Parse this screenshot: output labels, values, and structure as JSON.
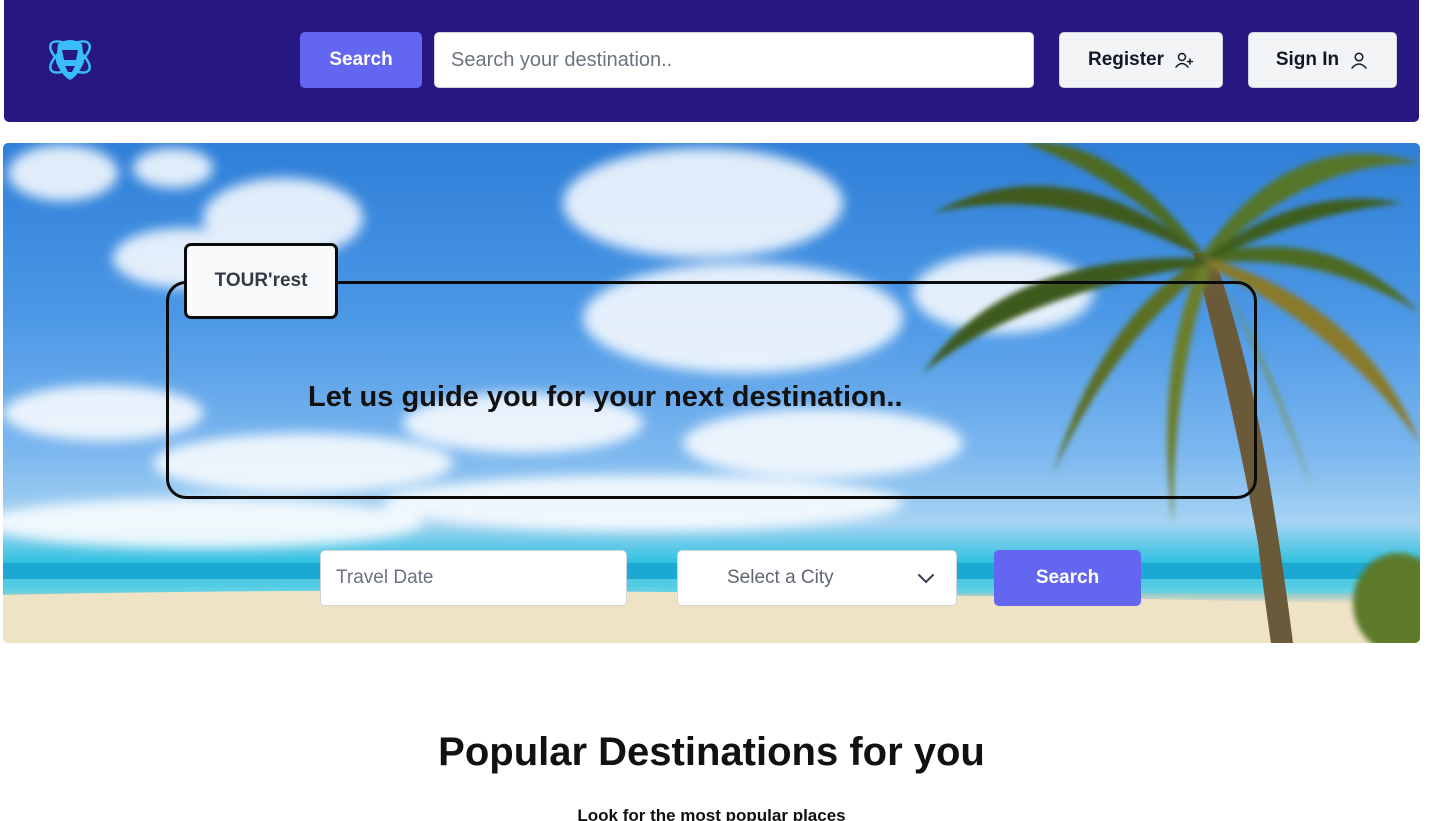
{
  "header": {
    "search_button": "Search",
    "search_placeholder": "Search your destination..",
    "register_button": "Register",
    "signin_button": "Sign In"
  },
  "hero": {
    "brand": "TOUR'rest",
    "tagline": "Let us guide you for your next destination..",
    "date_placeholder": "Travel Date",
    "city_select": "Select a City",
    "search_button": "Search"
  },
  "section": {
    "title": "Popular Destinations for you",
    "subtitle": "Look for the most popular places"
  },
  "colors": {
    "header_bg": "#261781",
    "accent": "#6366f1",
    "logo": "#38bdf8"
  },
  "icons": [
    "logo-icon",
    "user-plus-icon",
    "user-icon",
    "chevron-down-icon"
  ]
}
